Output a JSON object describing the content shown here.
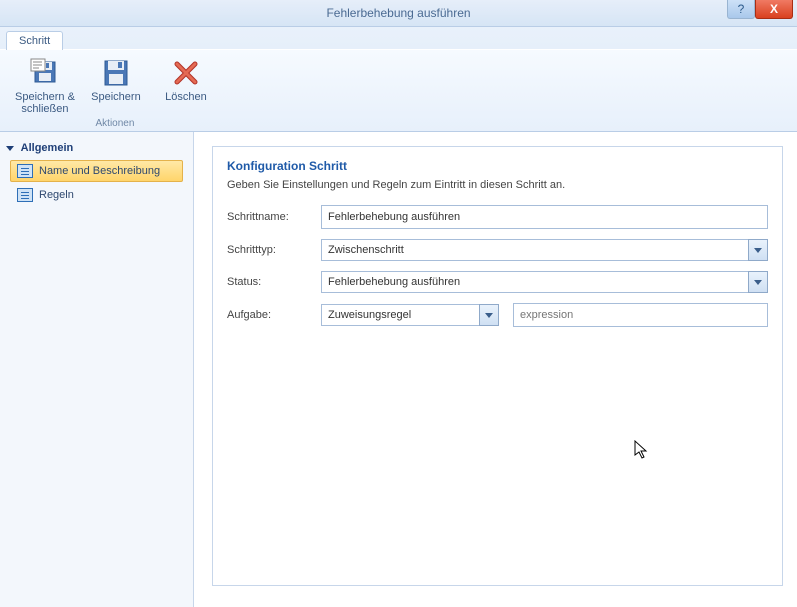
{
  "window": {
    "title": "Fehlerbehebung ausführen",
    "help_tooltip": "?",
    "close_tooltip": "X"
  },
  "ribbon": {
    "tab_label": "Schritt",
    "group_name": "Aktionen",
    "save_close": "Speichern &\nschließen",
    "save": "Speichern",
    "delete": "Löschen"
  },
  "nav": {
    "section": "Allgemein",
    "item_name_desc": "Name und Beschreibung",
    "item_rules": "Regeln"
  },
  "panel": {
    "title": "Konfiguration Schritt",
    "desc": "Geben Sie Einstellungen und Regeln zum Eintritt in diesen Schritt an.",
    "label_name": "Schrittname:",
    "value_name": "Fehlerbehebung ausführen",
    "label_type": "Schritttyp:",
    "value_type": "Zwischenschritt",
    "label_status": "Status:",
    "value_status": "Fehlerbehebung ausführen",
    "label_task": "Aufgabe:",
    "value_task": "Zuweisungsregel",
    "expr_placeholder": "expression"
  }
}
